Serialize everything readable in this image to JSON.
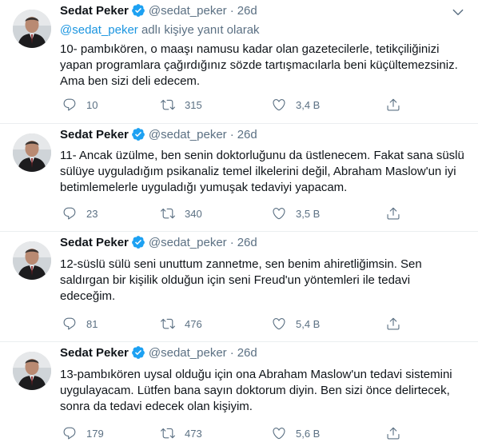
{
  "tweets": [
    {
      "name": "Sedat Peker",
      "handle": "@sedat_peker",
      "separator": "·",
      "time": "26d",
      "replying_mention": "@sedat_peker",
      "replying_suffix": " adlı kişiye yanıt olarak",
      "text": "10- pambıkören, o maaşı namusu kadar olan gazetecilerle, tetikçiliğinizi\nyapan programlara çağırdığınız sözde tartışmacılarla beni küçültemezsiniz.\nAma ben sizi deli edecem.",
      "replies": "10",
      "retweets": "315",
      "likes": "3,4 B"
    },
    {
      "name": "Sedat Peker",
      "handle": "@sedat_peker",
      "separator": "·",
      "time": "26d",
      "text": "11- Ancak üzülme, ben senin doktorluğunu da üstlenecem. Fakat sana süslü\nsülüye uyguladığım psikanaliz temel ilkelerini değil, Abraham Maslow'un iyi\nbetimlemelerle uyguladığı yumuşak tedaviyi yapacam.",
      "replies": "23",
      "retweets": "340",
      "likes": "3,5 B"
    },
    {
      "name": "Sedat Peker",
      "handle": "@sedat_peker",
      "separator": "·",
      "time": "26d",
      "text": "12-süslü sülü seni unuttum zannetme, sen benim ahiretliğimsin. Sen\nsaldırgan bir kişilik olduğun için seni Freud'un yöntemleri ile tedavi\nedeceğim.",
      "replies": "81",
      "retweets": "476",
      "likes": "5,4 B"
    },
    {
      "name": "Sedat Peker",
      "handle": "@sedat_peker",
      "separator": "·",
      "time": "26d",
      "text": "13-pambıkören uysal olduğu için ona Abraham Maslow'un tedavi sistemini\nuygulayacam. Lütfen bana sayın doktorum diyin. Ben sizi önce delirtecek,\nsonra da tedavi edecek olan kişiyim.",
      "replies": "179",
      "retweets": "473",
      "likes": "5,6 B"
    }
  ],
  "colors": {
    "verified": "#1da1f2",
    "secondary_text": "#5b7083",
    "link": "#1b95e0"
  },
  "icons": {
    "reply": "reply-icon",
    "retweet": "retweet-icon",
    "like": "heart-icon",
    "share": "share-icon",
    "more": "chevron-down-icon",
    "verified": "verified-badge-icon"
  }
}
